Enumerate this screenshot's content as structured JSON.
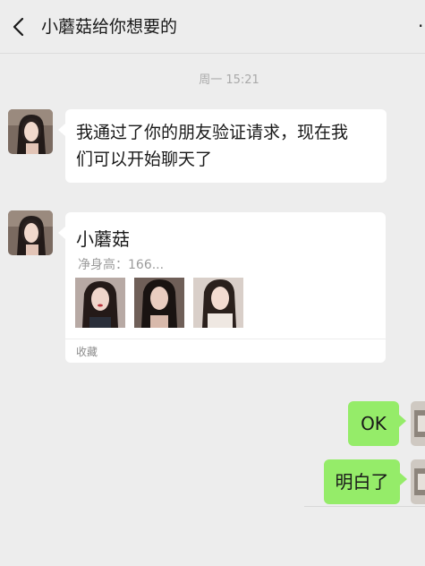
{
  "header": {
    "title": "小蘑菇给你想要的",
    "back_icon": "chevron-left-icon",
    "more_icon": "more-icon"
  },
  "chat": {
    "timestamp": "周一 15:21",
    "messages": [
      {
        "side": "left",
        "type": "text",
        "text_line1": "我通过了你的朋友验证请求，现在我",
        "text_line2": "们可以开始聊天了"
      },
      {
        "side": "left",
        "type": "favorite-card",
        "title": "小蘑菇",
        "description": "净身高：166...",
        "footer": "收藏",
        "thumbnails": [
          "photo-1",
          "photo-2",
          "photo-3"
        ]
      },
      {
        "side": "right",
        "type": "text",
        "text": "OK"
      },
      {
        "side": "right",
        "type": "text",
        "text": "明白了"
      }
    ]
  },
  "colors": {
    "background": "#ededed",
    "bubble_self": "#95ec69",
    "bubble_other": "#ffffff",
    "timestamp": "#a9a9a9"
  }
}
